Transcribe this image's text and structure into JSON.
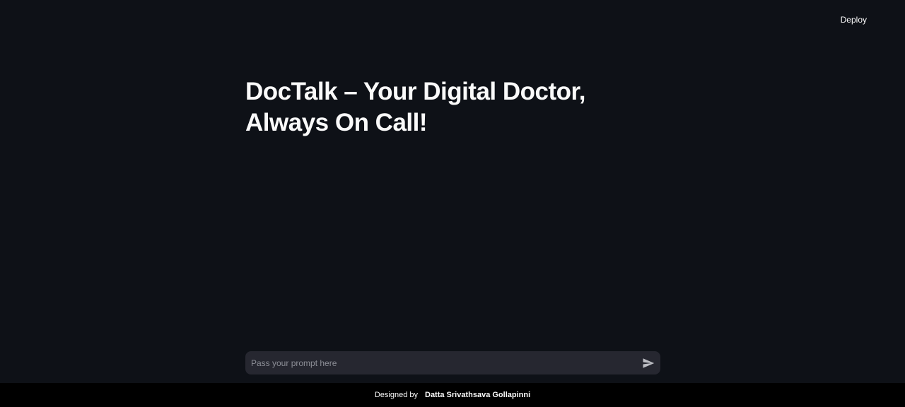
{
  "header": {
    "deploy_label": "Deploy"
  },
  "main": {
    "title": "DocTalk – Your Digital Doctor, Always On Call!"
  },
  "chat": {
    "placeholder": "Pass your prompt here",
    "send_icon": "send-icon"
  },
  "footer": {
    "designed_by": "Designed by",
    "author": "Datta Srivathsava Gollapinni"
  },
  "colors": {
    "background": "#0e1117",
    "input_background": "#262730",
    "footer_background": "#000000",
    "text": "#fafafa",
    "placeholder": "#8c8e96"
  }
}
